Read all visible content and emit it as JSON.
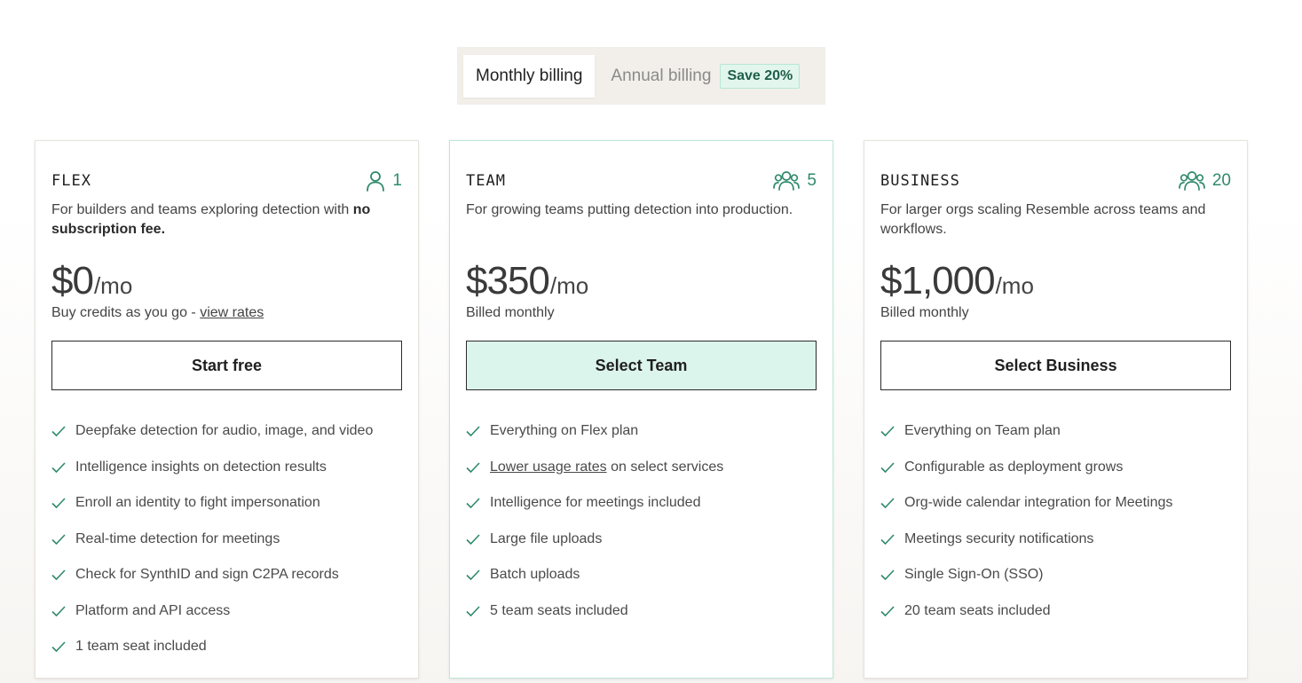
{
  "billing_toggle": {
    "monthly_label": "Monthly billing",
    "annual_label": "Annual billing",
    "save_badge": "Save 20%"
  },
  "colors": {
    "accent": "#2f8a6c",
    "accent_light": "#dcf5ec",
    "toggle_bg": "#f2efea"
  },
  "plans": [
    {
      "name": "FLEX",
      "seat_icon": "user-icon",
      "seats": "1",
      "description_plain": "For builders and teams exploring detection with ",
      "description_bold": "no subscription fee.",
      "price": "$0",
      "price_unit": "/mo",
      "note_text": "Buy credits as you go - ",
      "note_link": "view rates",
      "cta": "Start free",
      "features": [
        {
          "text": "Deepfake detection for audio, image, and video"
        },
        {
          "text": "Intelligence insights on detection results"
        },
        {
          "text": "Enroll an identity to fight impersonation"
        },
        {
          "text": "Real-time detection for meetings"
        },
        {
          "text": "Check for SynthID and sign C2PA records"
        },
        {
          "text": "Platform and API access"
        },
        {
          "text": "1 team seat included"
        }
      ]
    },
    {
      "name": "TEAM",
      "seat_icon": "users-icon",
      "seats": "5",
      "description_plain": "For growing teams putting detection into production.",
      "price": "$350",
      "price_unit": "/mo",
      "note_text": "Billed monthly",
      "cta": "Select Team",
      "features": [
        {
          "text": "Everything on Flex plan"
        },
        {
          "link": "Lower usage rates",
          "text": " on select services"
        },
        {
          "text": "Intelligence for meetings included"
        },
        {
          "text": "Large file uploads"
        },
        {
          "text": "Batch uploads"
        },
        {
          "text": "5 team seats included"
        }
      ]
    },
    {
      "name": "BUSINESS",
      "seat_icon": "users-icon",
      "seats": "20",
      "description_plain": "For larger orgs scaling Resemble across teams and workflows.",
      "price": "$1,000",
      "price_unit": "/mo",
      "note_text": "Billed monthly",
      "cta": "Select Business",
      "features": [
        {
          "text": "Everything on Team plan"
        },
        {
          "text": "Configurable as deployment grows"
        },
        {
          "text": "Org-wide calendar integration for Meetings"
        },
        {
          "text": "Meetings security notifications"
        },
        {
          "text": "Single Sign-On (SSO)"
        },
        {
          "text": "20 team seats included"
        }
      ]
    }
  ]
}
